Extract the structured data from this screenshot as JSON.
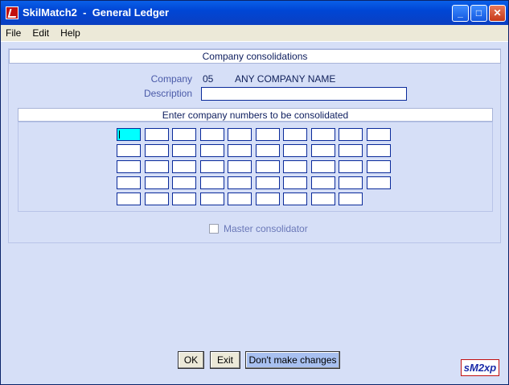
{
  "window": {
    "title": "SkilMatch2  -  General Ledger"
  },
  "menu": {
    "file": "File",
    "edit": "Edit",
    "help": "Help"
  },
  "header": {
    "title": "Company consolidations"
  },
  "company": {
    "label": "Company",
    "number": "05",
    "name": "ANY COMPANY NAME"
  },
  "description": {
    "label": "Description",
    "value": ""
  },
  "grid": {
    "title": "Enter company numbers to be consolidated",
    "rows": [
      10,
      10,
      10,
      10,
      9
    ]
  },
  "master": {
    "label": "Master consolidator",
    "checked": false
  },
  "buttons": {
    "ok": "OK",
    "exit": "Exit",
    "dont": "Don't make changes"
  },
  "logo": {
    "text": "sM2xp"
  }
}
